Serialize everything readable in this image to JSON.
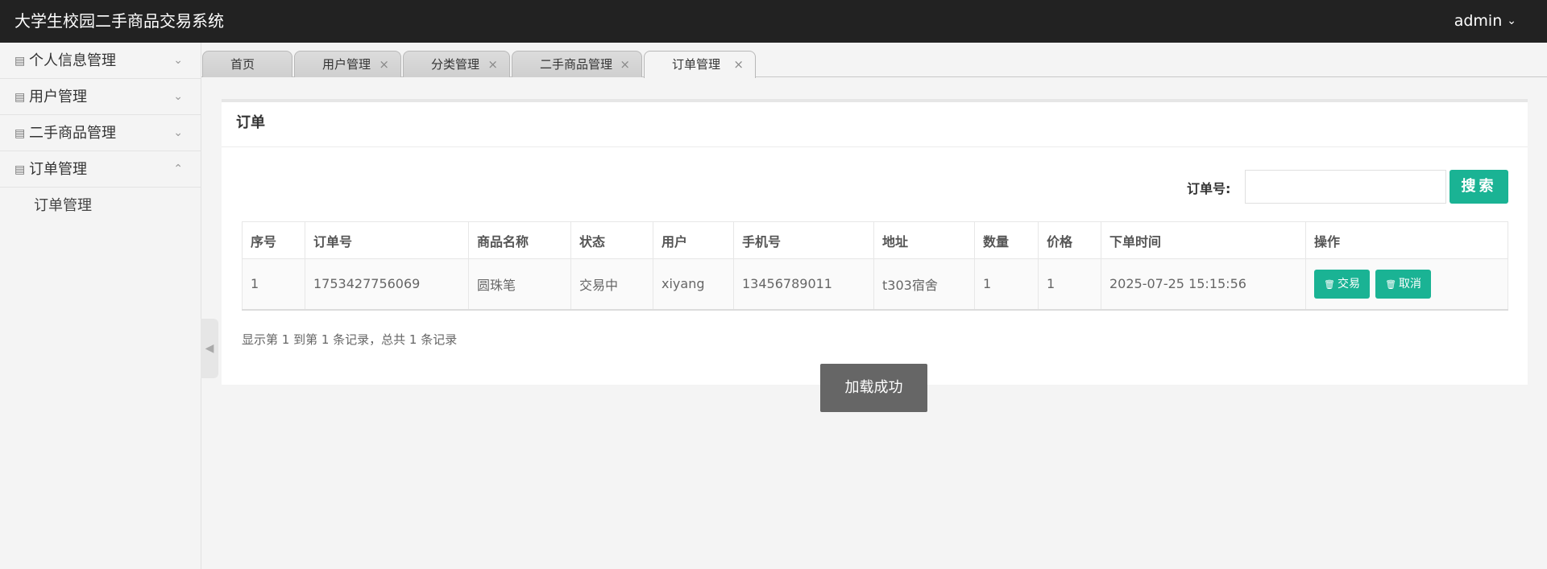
{
  "header": {
    "app_title": "大学生校园二手商品交易系统",
    "user_name": "admin"
  },
  "sidebar": {
    "items": [
      {
        "label": "个人信息管理",
        "expanded": false
      },
      {
        "label": "用户管理",
        "expanded": false
      },
      {
        "label": "二手商品管理",
        "expanded": false
      },
      {
        "label": "订单管理",
        "expanded": true
      }
    ],
    "submenu": [
      "订单管理"
    ]
  },
  "tabs": [
    {
      "label": "首页",
      "closable": false,
      "active": false
    },
    {
      "label": "用户管理",
      "closable": true,
      "active": false
    },
    {
      "label": "分类管理",
      "closable": true,
      "active": false
    },
    {
      "label": "二手商品管理",
      "closable": true,
      "active": false
    },
    {
      "label": "订单管理",
      "closable": true,
      "active": true
    }
  ],
  "panel": {
    "title": "订单",
    "search": {
      "label": "订单号:",
      "value": "",
      "button": "搜索"
    },
    "table": {
      "headers": [
        "序号",
        "订单号",
        "商品名称",
        "状态",
        "用户",
        "手机号",
        "地址",
        "数量",
        "价格",
        "下单时间",
        "操作"
      ],
      "rows": [
        [
          "1",
          "1753427756069",
          "圆珠笔",
          "交易中",
          "xiyang",
          "13456789011",
          "t303宿舍",
          "1",
          "1",
          "2025-07-25 15:15:56"
        ]
      ],
      "actions": [
        "交易",
        "取消"
      ]
    },
    "summary": "显示第 1 到第 1 条记录，总共 1 条记录"
  },
  "toast": "加载成功",
  "colors": {
    "accent": "#1ab394",
    "header_bg": "#222222"
  },
  "icons": {
    "menu_icon": "list-icon",
    "action_icon": "trash-icon"
  }
}
